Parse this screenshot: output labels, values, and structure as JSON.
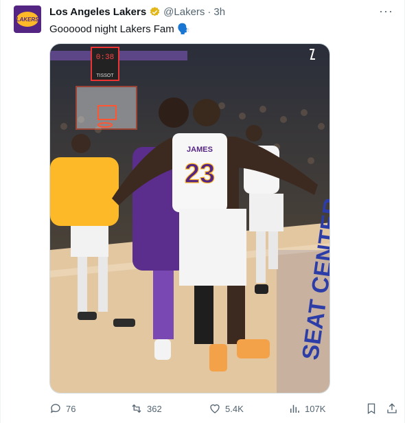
{
  "tweet": {
    "author_name": "Los Angeles Lakers",
    "handle": "@Lakers",
    "separator": "·",
    "time": "3h",
    "text": "Goooood night Lakers Fam 🗣️",
    "avatar_text": "LAKERS",
    "more_label": "···"
  },
  "media": {
    "jersey_name": "JAMES",
    "jersey_number": "23",
    "court_text": "SEAT CENTER",
    "board_text": "TISSOT",
    "shot_clock": "0:38"
  },
  "actions": {
    "replies": "76",
    "retweets": "362",
    "likes": "5.4K",
    "views": "107K"
  },
  "colors": {
    "lakers_purple": "#552583",
    "lakers_gold": "#fdb927",
    "verified_gold": "#e2b719"
  }
}
